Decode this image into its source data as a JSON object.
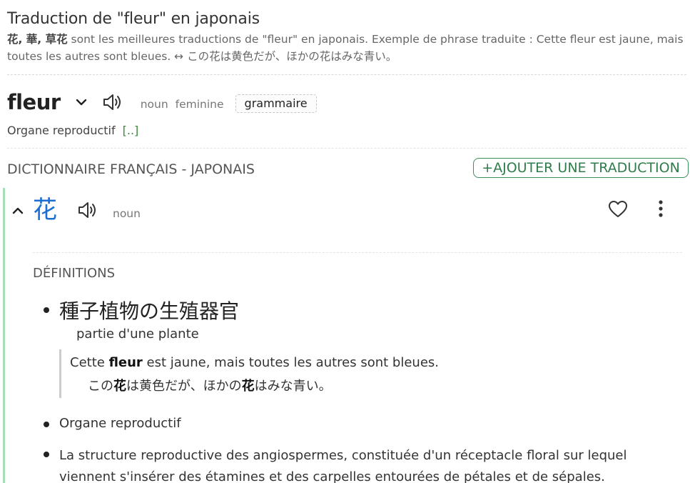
{
  "page_title": "Traduction de \"fleur\" en japonais",
  "summary": {
    "translations": "花, 華, 草花",
    "text": " sont les meilleures traductions de \"fleur\" en japonais. Exemple de phrase traduite : Cette fleur est jaune, mais toutes les autres sont bleues. ↔ この花は黄色だが、ほかの花はみな青い。"
  },
  "headword": {
    "word": "fleur",
    "pos": "noun",
    "gender": "feminine",
    "grammar_button": "grammaire",
    "gloss": "Organe reproductif",
    "more": "[..]"
  },
  "dictionary": {
    "label": "DICTIONNAIRE FRANÇAIS - JAPONAIS",
    "add_button": "+AJOUTER UNE TRADUCTION"
  },
  "entry": {
    "term": "花",
    "pos": "noun",
    "definitions_label": "DÉFINITIONS",
    "definitions": [
      {
        "text": "種子植物の生殖器官",
        "gloss": "partie d'une plante",
        "example": {
          "fr_before": "Cette ",
          "fr_bold": "fleur",
          "fr_after": " est jaune, mais toutes les autres sont bleues.",
          "jp_1": "この",
          "jp_b1": "花",
          "jp_2": "は黄色だが、ほかの",
          "jp_b2": "花",
          "jp_3": "はみな青い。"
        }
      },
      {
        "text": "Organe reproductif"
      },
      {
        "text": "La structure reproductive des angiospermes, constituée d'un réceptacle floral sur lequel viennent s'insérer des étamines et des carpelles entourées de pétales et de sépales."
      }
    ]
  },
  "colors": {
    "accent_green": "#2e7d4a",
    "term_blue": "#1b6fd1",
    "entry_bar": "#a5e0b5"
  },
  "icons": [
    "chevron-down-icon",
    "speaker-icon",
    "chevron-up-icon",
    "heart-icon",
    "more-vertical-icon"
  ]
}
